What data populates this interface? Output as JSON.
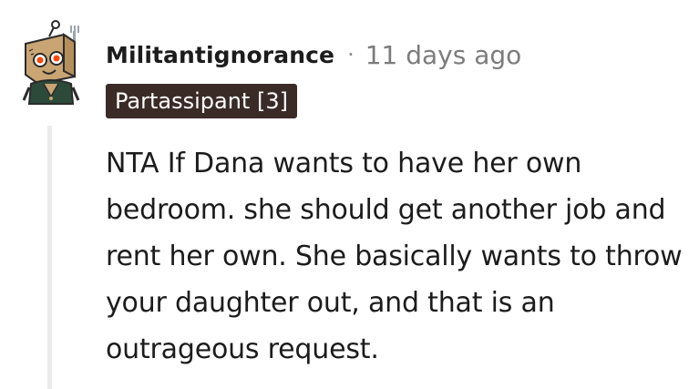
{
  "comment": {
    "avatar_icon": "snoo-avatar-icon",
    "username": "Militantignorance",
    "separator": "·",
    "timestamp": "11 days ago",
    "flair": "Partassipant [3]",
    "flair_color": "#3b2b27",
    "body": "NTA If Dana wants to have her own bedroom. she should get another job and rent her own. She basically wants to throw your daughter out, and that is an outrageous request."
  }
}
